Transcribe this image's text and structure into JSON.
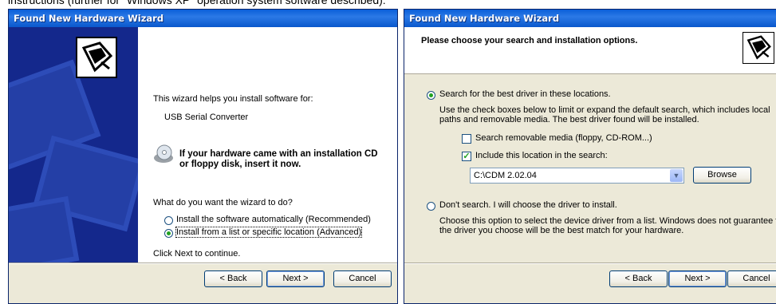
{
  "caption": "instructions (further for \"Windows XP\" operation system software described):",
  "window1": {
    "title": "Found New Hardware Wizard",
    "intro": "This wizard helps you install software for:",
    "device": "USB Serial Converter",
    "cd_prompt_line1": "If your hardware came with an installation CD",
    "cd_prompt_line2": "or floppy disk, insert it now.",
    "question": "What do you want the wizard to do?",
    "option_auto": "Install the software automatically (Recommended)",
    "option_list": "Install from a list or specific location (Advanced)",
    "continue_text": "Click Next to continue.",
    "back_label": "< Back",
    "next_label": "Next >",
    "cancel_label": "Cancel"
  },
  "window2": {
    "title": "Found New Hardware Wizard",
    "header": "Please choose your search and installation options.",
    "option_search": "Search for the best driver in these locations.",
    "search_desc_line1": "Use the check boxes below to limit or expand the default search, which includes local",
    "search_desc_line2": "paths and removable media. The best driver found will be installed.",
    "check_removable": "Search removable media (floppy, CD-ROM...)",
    "check_include": "Include this location in the search:",
    "location_value": "C:\\CDM 2.02.04",
    "browse_label": "Browse",
    "option_dont": "Don't search. I will choose the driver to install.",
    "dont_desc_line1": "Choose this option to select the device driver from a list.  Windows does not guarantee that",
    "dont_desc_line2": "the driver you choose will be the best match for your hardware.",
    "back_label": "< Back",
    "next_label": "Next >",
    "cancel_label": "Cancel"
  },
  "icons": [
    "hardware-wizard-logo-icon",
    "cd-icon",
    "radio-icon",
    "checkbox-icon",
    "dropdown-arrow-icon"
  ],
  "colors": {
    "titlebar": "#0a5fd8",
    "sidepanel": "#14288c",
    "dialog_bg": "#ece9d8"
  }
}
